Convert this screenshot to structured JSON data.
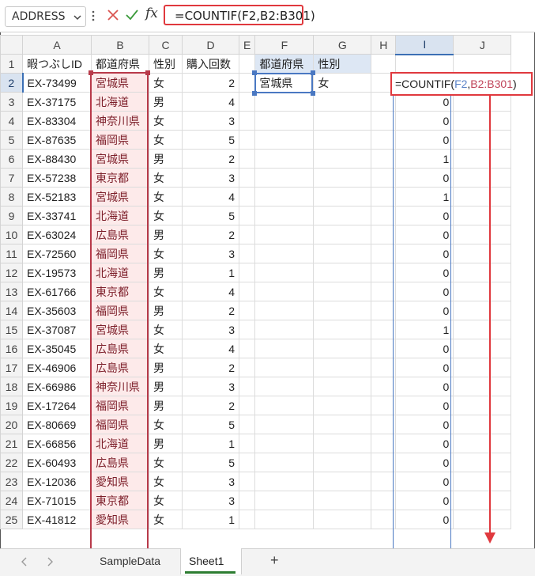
{
  "formula_bar": {
    "name_box": "ADDRESS",
    "formula": "=COUNTIF(F2,B2:B301)",
    "cancel_icon": "x-mark-icon",
    "enter_icon": "check-mark-icon",
    "function_icon": "fx-icon",
    "fx_label": "fx"
  },
  "columns": [
    "A",
    "B",
    "C",
    "D",
    "E",
    "F",
    "G",
    "H",
    "I",
    "J"
  ],
  "header_row": {
    "a": "暇つぶしID",
    "b": "都道府県",
    "c": "性別",
    "d": "購入回数",
    "f": "都道府県",
    "g": "性別"
  },
  "criteria": {
    "f2": "宮城県",
    "g2": "女"
  },
  "active_cell": {
    "prefix": "=COUNTIF(",
    "ref1": "F2",
    "comma": ",",
    "ref2": "B2:B301",
    "suffix": ")"
  },
  "rows": [
    {
      "n": "2",
      "id": "EX-73499",
      "pref": "宮城県",
      "sex": "女",
      "count": "2",
      "result": ""
    },
    {
      "n": "3",
      "id": "EX-37175",
      "pref": "北海道",
      "sex": "男",
      "count": "4",
      "result": "0"
    },
    {
      "n": "4",
      "id": "EX-83304",
      "pref": "神奈川県",
      "sex": "女",
      "count": "3",
      "result": "0"
    },
    {
      "n": "5",
      "id": "EX-87635",
      "pref": "福岡県",
      "sex": "女",
      "count": "5",
      "result": "0"
    },
    {
      "n": "6",
      "id": "EX-88430",
      "pref": "宮城県",
      "sex": "男",
      "count": "2",
      "result": "1"
    },
    {
      "n": "7",
      "id": "EX-57238",
      "pref": "東京都",
      "sex": "女",
      "count": "3",
      "result": "0"
    },
    {
      "n": "8",
      "id": "EX-52183",
      "pref": "宮城県",
      "sex": "女",
      "count": "4",
      "result": "1"
    },
    {
      "n": "9",
      "id": "EX-33741",
      "pref": "北海道",
      "sex": "女",
      "count": "5",
      "result": "0"
    },
    {
      "n": "10",
      "id": "EX-63024",
      "pref": "広島県",
      "sex": "男",
      "count": "2",
      "result": "0"
    },
    {
      "n": "11",
      "id": "EX-72560",
      "pref": "福岡県",
      "sex": "女",
      "count": "3",
      "result": "0"
    },
    {
      "n": "12",
      "id": "EX-19573",
      "pref": "北海道",
      "sex": "男",
      "count": "1",
      "result": "0"
    },
    {
      "n": "13",
      "id": "EX-61766",
      "pref": "東京都",
      "sex": "女",
      "count": "4",
      "result": "0"
    },
    {
      "n": "14",
      "id": "EX-35603",
      "pref": "福岡県",
      "sex": "男",
      "count": "2",
      "result": "0"
    },
    {
      "n": "15",
      "id": "EX-37087",
      "pref": "宮城県",
      "sex": "女",
      "count": "3",
      "result": "1"
    },
    {
      "n": "16",
      "id": "EX-35045",
      "pref": "広島県",
      "sex": "女",
      "count": "4",
      "result": "0"
    },
    {
      "n": "17",
      "id": "EX-46906",
      "pref": "広島県",
      "sex": "男",
      "count": "2",
      "result": "0"
    },
    {
      "n": "18",
      "id": "EX-66986",
      "pref": "神奈川県",
      "sex": "男",
      "count": "3",
      "result": "0"
    },
    {
      "n": "19",
      "id": "EX-17264",
      "pref": "福岡県",
      "sex": "男",
      "count": "2",
      "result": "0"
    },
    {
      "n": "20",
      "id": "EX-80669",
      "pref": "福岡県",
      "sex": "女",
      "count": "5",
      "result": "0"
    },
    {
      "n": "21",
      "id": "EX-66856",
      "pref": "北海道",
      "sex": "男",
      "count": "1",
      "result": "0"
    },
    {
      "n": "22",
      "id": "EX-60493",
      "pref": "広島県",
      "sex": "女",
      "count": "5",
      "result": "0"
    },
    {
      "n": "23",
      "id": "EX-12036",
      "pref": "愛知県",
      "sex": "女",
      "count": "3",
      "result": "0"
    },
    {
      "n": "24",
      "id": "EX-71015",
      "pref": "東京都",
      "sex": "女",
      "count": "3",
      "result": "0"
    },
    {
      "n": "25",
      "id": "EX-41812",
      "pref": "愛知県",
      "sex": "女",
      "count": "1",
      "result": "0"
    }
  ],
  "tabs": {
    "items": [
      "SampleData",
      "Sheet1"
    ],
    "active": "Sheet1",
    "add_label": "+"
  },
  "colors": {
    "accent_red": "#e0393e",
    "range_b": "#b83a4a",
    "range_f": "#4a78c2",
    "active_tab": "#2e7d32"
  }
}
